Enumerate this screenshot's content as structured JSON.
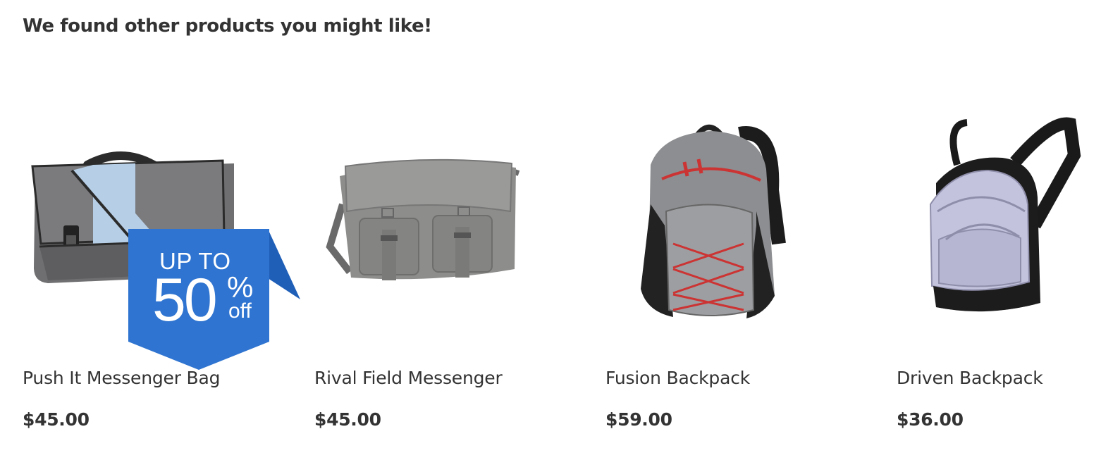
{
  "section": {
    "heading": "We found other products you might like!"
  },
  "products": [
    {
      "name": "Push It Messenger Bag",
      "price": "$45.00",
      "image": "messenger-bag-gray-blue",
      "badge": {
        "line1": "UP TO",
        "number": "50",
        "percent": "%",
        "suffix": "off",
        "color": "#2f74d0"
      }
    },
    {
      "name": "Rival Field Messenger",
      "price": "$45.00",
      "image": "messenger-bag-gray-canvas"
    },
    {
      "name": "Fusion Backpack",
      "price": "$59.00",
      "image": "backpack-gray-red"
    },
    {
      "name": "Driven Backpack",
      "price": "$36.00",
      "image": "backpack-lavender-black"
    }
  ]
}
